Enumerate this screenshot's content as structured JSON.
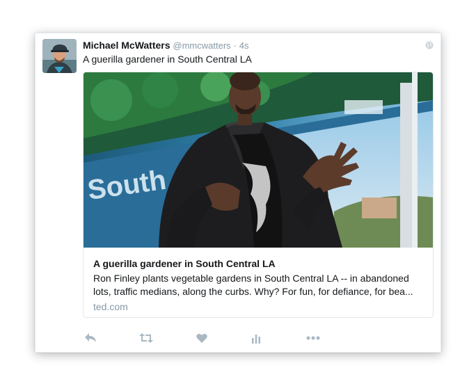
{
  "tweet": {
    "author": {
      "display_name": "Michael McWatters",
      "handle": "@mmcwatters"
    },
    "separator": "·",
    "timestamp": "4s",
    "text": "A guerilla gardener in South Central LA",
    "visibility_icon": "globe-icon",
    "link_card": {
      "image_caption_text": "South",
      "title": "A guerilla gardener in South Central LA",
      "description": "Ron Finley plants vegetable gardens in South Central LA -- in abandoned lots, traffic medians, along the curbs. Why? For fun, for defiance, for bea...",
      "domain": "ted.com"
    },
    "actions": [
      {
        "name": "reply-icon"
      },
      {
        "name": "retweet-icon"
      },
      {
        "name": "like-icon"
      },
      {
        "name": "analytics-icon"
      },
      {
        "name": "more-icon"
      }
    ]
  },
  "colors": {
    "text_primary": "#14171a",
    "text_secondary": "#8899a6",
    "action_icon": "#aab8c2",
    "border": "#e1e8ed"
  }
}
